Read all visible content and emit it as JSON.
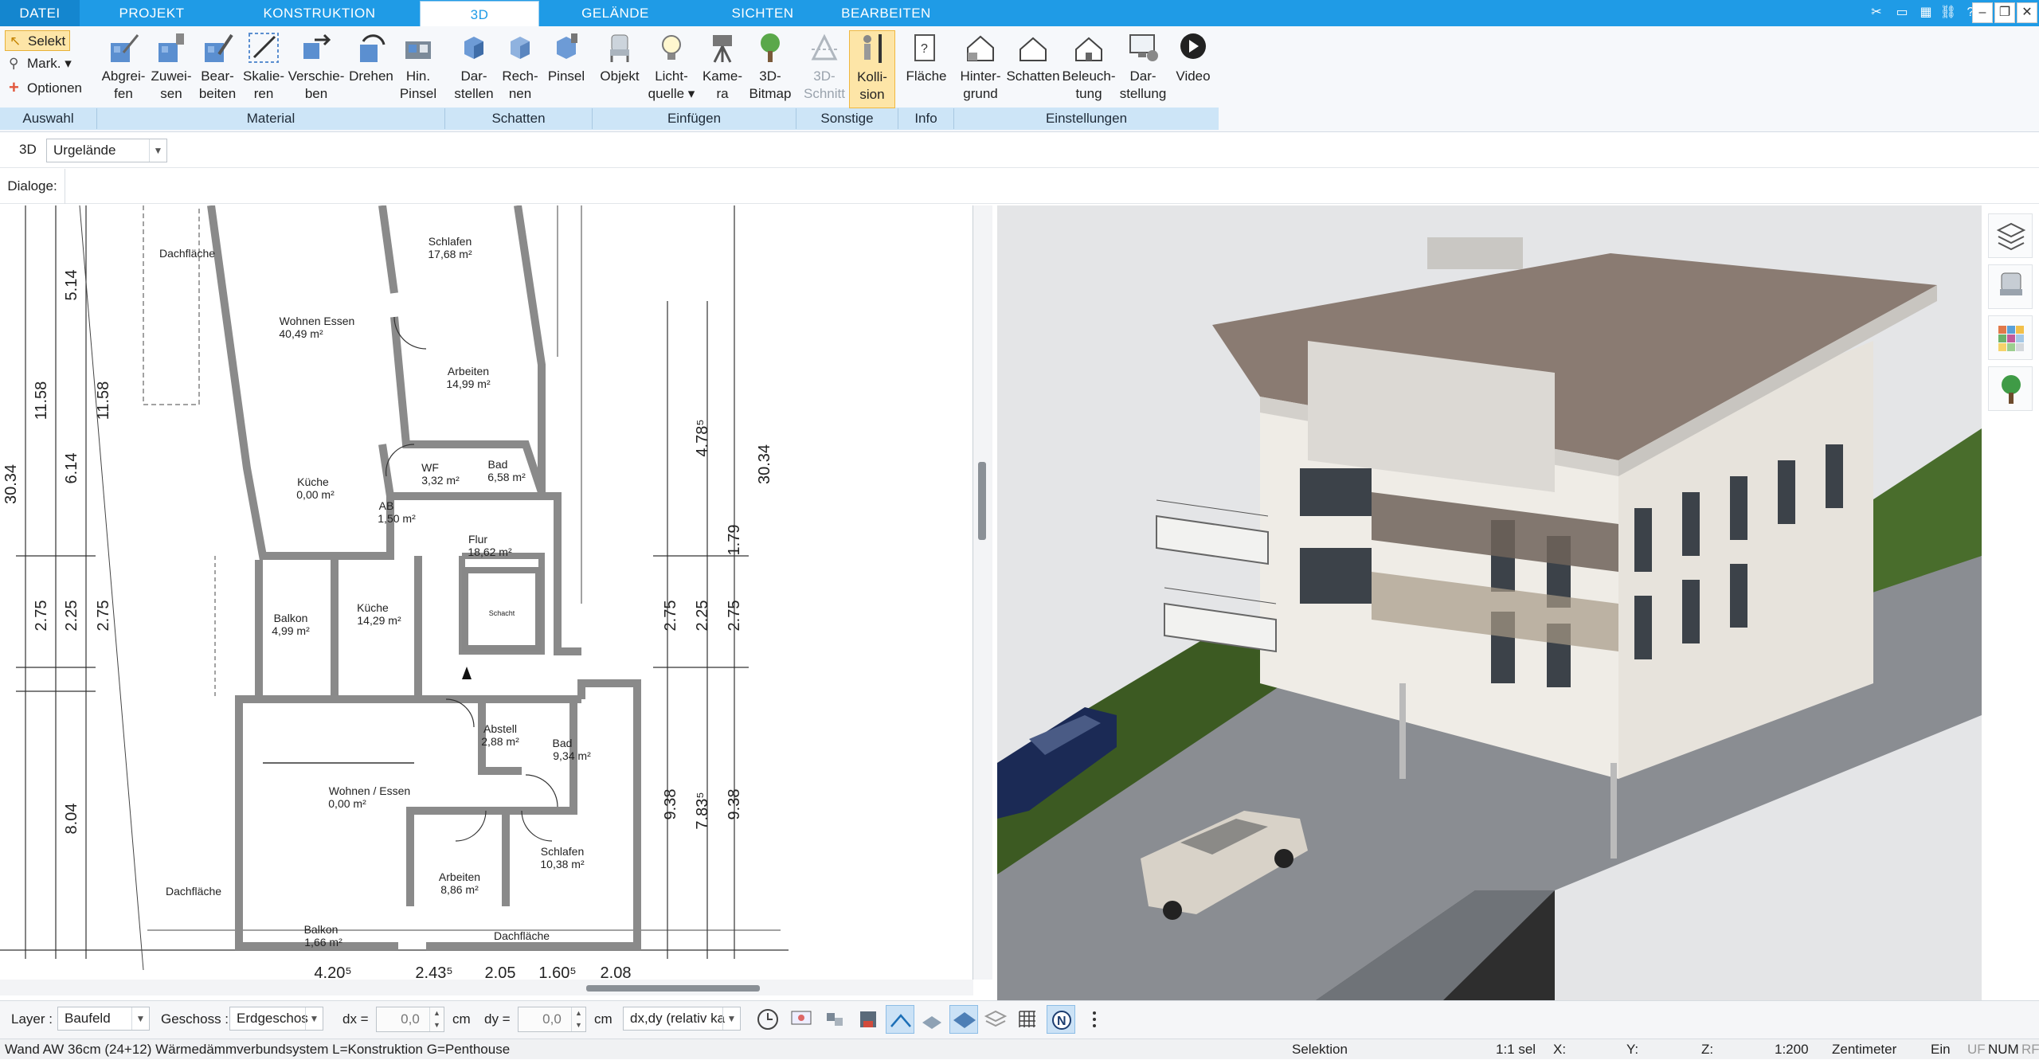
{
  "tabs": [
    {
      "label": "DATEI"
    },
    {
      "label": "PROJEKT"
    },
    {
      "label": "KONSTRUKTION"
    },
    {
      "label": "3D"
    },
    {
      "label": "GELÄNDE"
    },
    {
      "label": "SICHTEN"
    },
    {
      "label": "BEARBEITEN"
    }
  ],
  "ribbon": {
    "auswahl": {
      "select": "Selekt",
      "mark": "Mark.",
      "options": "Optionen",
      "group": "Auswahl"
    },
    "material": {
      "group": "Material",
      "buttons": [
        {
          "l1": "Abgrei-",
          "l2": "fen"
        },
        {
          "l1": "Zuwei-",
          "l2": "sen"
        },
        {
          "l1": "Bear-",
          "l2": "beiten"
        },
        {
          "l1": "Skalie-",
          "l2": "ren"
        },
        {
          "l1": "Verschie-",
          "l2": "ben"
        },
        {
          "l1": "Drehen",
          "l2": ""
        },
        {
          "l1": "Hin.",
          "l2": "Pinsel"
        }
      ]
    },
    "schatten": {
      "group": "Schatten",
      "buttons": [
        {
          "l1": "Dar-",
          "l2": "stellen"
        },
        {
          "l1": "Rech-",
          "l2": "nen"
        },
        {
          "l1": "Pinsel",
          "l2": ""
        }
      ]
    },
    "einfuegen": {
      "group": "Einfügen",
      "buttons": [
        {
          "l1": "Objekt",
          "l2": ""
        },
        {
          "l1": "Licht-",
          "l2": "quelle"
        },
        {
          "l1": "Kame-",
          "l2": "ra"
        },
        {
          "l1": "3D-",
          "l2": "Bitmap"
        }
      ]
    },
    "sonstige": {
      "group": "Sonstige",
      "buttons": [
        {
          "l1": "3D-",
          "l2": "Schnitt"
        },
        {
          "l1": "Kolli-",
          "l2": "sion"
        }
      ]
    },
    "info": {
      "group": "Info",
      "buttons": [
        {
          "l1": "Fläche",
          "l2": ""
        }
      ]
    },
    "einstellungen": {
      "group": "Einstellungen",
      "buttons": [
        {
          "l1": "Hinter-",
          "l2": "grund"
        },
        {
          "l1": "Schatten",
          "l2": ""
        },
        {
          "l1": "Beleuch-",
          "l2": "tung"
        },
        {
          "l1": "Dar-",
          "l2": "stellung"
        },
        {
          "l1": "Video",
          "l2": ""
        }
      ]
    }
  },
  "toolbar3d": {
    "label": "3D",
    "combo_value": "Urgelände"
  },
  "dialog_row": {
    "label": "Dialoge:"
  },
  "plan": {
    "rooms": [
      {
        "name": "Dachfläche",
        "area": ""
      },
      {
        "name": "Schlafen",
        "area": "17,68 m²"
      },
      {
        "name": "Wohnen Essen",
        "area": "40,49 m²"
      },
      {
        "name": "Arbeiten",
        "area": "14,99 m²"
      },
      {
        "name": "WF",
        "area": "3,32 m²"
      },
      {
        "name": "Bad",
        "area": "6,58 m²"
      },
      {
        "name": "Küche",
        "area": "0,00 m²"
      },
      {
        "name": "AB",
        "area": "1,50 m²"
      },
      {
        "name": "Flur",
        "area": "18,62 m²"
      },
      {
        "name": "Schacht",
        "area": ""
      },
      {
        "name": "Balkon",
        "area": "4,99 m²"
      },
      {
        "name": "Küche",
        "area": "14,29 m²"
      },
      {
        "name": "Abstell",
        "area": "2,88 m²"
      },
      {
        "name": "Bad",
        "area": "9,34 m²"
      },
      {
        "name": "Wohnen / Essen",
        "area": "0,00 m²"
      },
      {
        "name": "Schlafen",
        "area": "10,38 m²"
      },
      {
        "name": "Arbeiten",
        "area": "8,86 m²"
      },
      {
        "name": "Dachfläche",
        "area": ""
      },
      {
        "name": "Balkon",
        "area": "1,66 m²"
      },
      {
        "name": "Dachfläche",
        "area": ""
      }
    ],
    "dims_left": [
      "30.34",
      "11.58",
      "5.14",
      "6.14",
      "2.75",
      "8.04",
      "11.58",
      "2.25",
      "2.75"
    ],
    "dims_right": [
      "30.34",
      "4.78⁵",
      "1.79",
      "2.75",
      "2.25",
      "2.75",
      "9.38",
      "7.83⁵",
      "9.38"
    ],
    "dims_bottom": [
      "4.20⁵",
      "2.43⁵",
      "2.05",
      "1.60⁵",
      "2.08"
    ]
  },
  "bottom": {
    "layer_label": "Layer :",
    "layer_value": "Baufeld",
    "geschoss_label": "Geschoss :",
    "geschoss_value": "Erdgeschos",
    "dx_label": "dx =",
    "dx_value": "0,0",
    "dx_unit": "cm",
    "dy_label": "dy =",
    "dy_value": "0,0",
    "dy_unit": "cm",
    "mode_value": "dx,dy (relativ ka"
  },
  "status": {
    "element": "Wand AW 36cm (24+12) Wärmedämmverbundsystem L=Konstruktion G=Penthouse",
    "mode": "Selektion",
    "sel": "1:1 sel",
    "x": "X:",
    "y": "Y:",
    "z": "Z:",
    "scale": "1:200",
    "unit": "Zentimeter",
    "ein": "Ein",
    "uf": "UF",
    "num": "NUM",
    "rf": "RF"
  },
  "colors": {
    "accent": "#1f9be6",
    "ribbon_group": "#cde5f7",
    "pressed": "#fde5a7",
    "wall": "#8a8a8a"
  }
}
